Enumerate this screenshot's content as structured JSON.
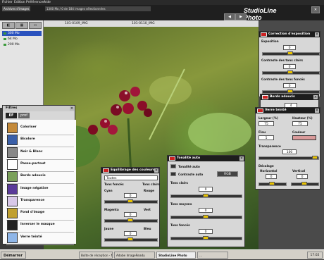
{
  "menu": [
    "Fichier",
    "Edition",
    "Préférences",
    "Aide"
  ],
  "toolbar": {
    "breadcrumb": "Archives d'images",
    "selection": "1300 Mo / 0 de 184 images sélectionnées",
    "brand": "StudioLine Photo",
    "buttons": [
      "◀",
      "▶",
      "✕"
    ]
  },
  "albums": {
    "tabs": [
      "◧",
      "▦",
      "▭"
    ],
    "items": [
      {
        "label": "300 Mo",
        "selected": true
      },
      {
        "label": "64 Mo",
        "selected": false
      },
      {
        "label": "200 Mo",
        "selected": false
      }
    ]
  },
  "thumbstrip": {
    "file1": "101-0109_IMG",
    "file2": "101-0110_IMG"
  },
  "filters_panel": {
    "title": "Filtres",
    "tabs": [
      "EF",
      "prof"
    ],
    "items": [
      {
        "label": "Coloriser",
        "icon": "coloriser-icon",
        "color": "#c48a3a"
      },
      {
        "label": "Bicolore",
        "icon": "bicolore-icon",
        "color": "#3a5fa8"
      },
      {
        "label": "Noir & Blanc",
        "icon": "noir-blanc-icon",
        "color": "#888888"
      },
      {
        "label": "Passe-partout",
        "icon": "passe-partout-icon",
        "color": "#ffffff"
      },
      {
        "label": "Bords adoucis",
        "icon": "bords-adoucis-icon",
        "color": "#7aa05a"
      },
      {
        "label": "Image négative",
        "icon": "negative-icon",
        "color": "#5a3a9a"
      },
      {
        "label": "Transparence",
        "icon": "transparence-icon",
        "color": "#d8c8e8"
      },
      {
        "label": "Fond d'image",
        "icon": "fond-image-icon",
        "color": "#c0a030"
      },
      {
        "label": "Inverser le masque",
        "icon": "inverser-masque-icon",
        "color": "#222222"
      },
      {
        "label": "Verre teinté",
        "icon": "verre-teinte-icon",
        "color": "#8fb6e8"
      }
    ]
  },
  "color_balance": {
    "title": "Equilibrage des couleurs",
    "dropdown": "Toutes",
    "left_label": "Tons foncés",
    "right_label": "Tons clairs",
    "rows": [
      {
        "left": "Cyan",
        "right": "Rouge",
        "value": "0",
        "level": 0.5
      },
      {
        "left": "Magenta",
        "right": "Vert",
        "value": "0",
        "level": 0.5
      },
      {
        "left": "Jaune",
        "right": "Bleu",
        "value": "0",
        "level": 0.5
      }
    ]
  },
  "auto_tone": {
    "title": "Tonalité auto",
    "opt1": "Tonalité auto",
    "opt2": "Contraste auto",
    "rgb_button": "RGB",
    "rows": [
      {
        "label": "Tons clairs",
        "value": "0",
        "level": 0.5
      },
      {
        "label": "Tons moyens",
        "value": "0",
        "level": 0.5
      },
      {
        "label": "Tons foncés",
        "value": "0",
        "level": 0.5
      }
    ]
  },
  "exposure": {
    "title": "Correction d'exposition",
    "rows": [
      {
        "label": "Exposition",
        "value": "0",
        "level": 0.5
      },
      {
        "label": "Contraste des tons clairs",
        "value": "0",
        "level": 0.5
      },
      {
        "label": "Contraste des tons foncés",
        "value": "0",
        "level": 0.5
      }
    ]
  },
  "soft_edges": {
    "title": "Bords adoucis",
    "value": "4"
  },
  "tinted_glass": {
    "title": "Verre teinté",
    "width_label": "Largeur (%)",
    "height_label": "Hauteur (%)",
    "width_value": "75",
    "height_value": "75",
    "flou_label": "Flou",
    "flou_value": "5",
    "couleur_label": "Couleur",
    "swatch_color": "#d99a9a",
    "transparence_label": "Transparence",
    "transparence_value": "100",
    "decalage_label": "Décalage",
    "horizontal_label": "Horizontal",
    "vertical_label": "Vertical",
    "horizontal_value": "0",
    "vertical_value": "0"
  },
  "taskbar": {
    "start": "Démarrer",
    "items": [
      {
        "label": "Boîte de réception - M...",
        "active": false
      },
      {
        "label": "Adobe ImageReady",
        "active": false
      },
      {
        "label": "StudioLine Photo",
        "active": true
      },
      {
        "label": "...",
        "active": false
      }
    ],
    "clock": "17:02"
  }
}
